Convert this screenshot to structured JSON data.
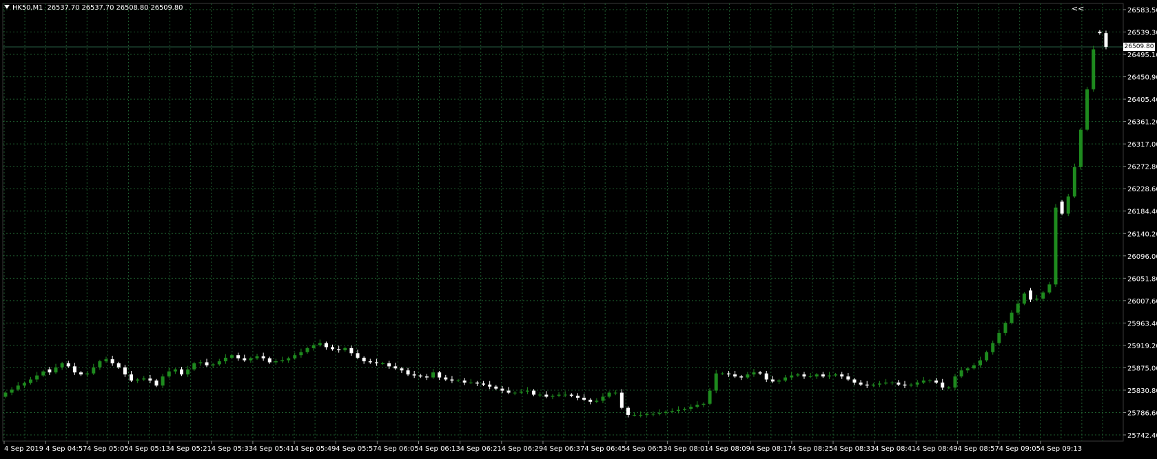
{
  "symbol_info": {
    "symbol": "HK50,M1",
    "open": "26537.70",
    "high": "26537.70",
    "low": "26508.80",
    "close": "26509.80"
  },
  "shift_button_label": "<<",
  "current_price_label": "26509.80",
  "colors": {
    "background": "#000000",
    "grid": "#1e5c2e",
    "bull_candle": "#1e8a1e",
    "bear_candle": "#ffffff",
    "bid_line": "#2e6e4e",
    "axis_text": "#ffffff"
  },
  "chart_data": {
    "type": "candlestick",
    "timeframe": "M1",
    "ylim": [
      25742.4,
      26583.5
    ],
    "grid": true,
    "y_tick_labels": [
      "26583.50",
      "26539.30",
      "26495.10",
      "26450.90",
      "26405.40",
      "26361.20",
      "26317.00",
      "26272.80",
      "26228.60",
      "26184.40",
      "26140.20",
      "26096.00",
      "26051.80",
      "26007.60",
      "25963.40",
      "25919.20",
      "25875.00",
      "25830.80",
      "25786.60",
      "25742.40"
    ],
    "x_tick_labels": [
      "4 Sep 2019",
      "4 Sep 04:57",
      "4 Sep 05:05",
      "4 Sep 05:13",
      "4 Sep 05:21",
      "4 Sep 05:33",
      "4 Sep 05:41",
      "4 Sep 05:49",
      "4 Sep 05:57",
      "4 Sep 06:05",
      "4 Sep 06:13",
      "4 Sep 06:21",
      "4 Sep 06:29",
      "4 Sep 06:37",
      "4 Sep 06:45",
      "4 Sep 06:53",
      "4 Sep 08:01",
      "4 Sep 08:09",
      "4 Sep 08:17",
      "4 Sep 08:25",
      "4 Sep 08:33",
      "4 Sep 08:41",
      "4 Sep 08:49",
      "4 Sep 08:57",
      "4 Sep 09:05",
      "4 Sep 09:13"
    ],
    "bid_line": 26509.8,
    "closes": [
      25826,
      25832,
      25840,
      25845,
      25852,
      25860,
      25868,
      25866,
      25876,
      25884,
      25878,
      25866,
      25862,
      25864,
      25876,
      25888,
      25892,
      25884,
      25876,
      25862,
      25850,
      25852,
      25854,
      25850,
      25840,
      25858,
      25868,
      25872,
      25862,
      25872,
      25884,
      25886,
      25880,
      25882,
      25888,
      25895,
      25900,
      25894,
      25890,
      25894,
      25898,
      25894,
      25886,
      25888,
      25890,
      25894,
      25900,
      25906,
      25914,
      25920,
      25924,
      25916,
      25912,
      25910,
      25914,
      25904,
      25895,
      25888,
      25886,
      25884,
      25884,
      25878,
      25874,
      25870,
      25862,
      25860,
      25858,
      25856,
      25866,
      25856,
      25852,
      25850,
      25850,
      25846,
      25846,
      25844,
      25842,
      25838,
      25834,
      25830,
      25826,
      25826,
      25828,
      25830,
      25822,
      25822,
      25818,
      25820,
      25822,
      25822,
      25820,
      25816,
      25812,
      25808,
      25810,
      25818,
      25826,
      25826,
      25796,
      25782,
      25782,
      25782,
      25784,
      25784,
      25786,
      25788,
      25790,
      25792,
      25794,
      25798,
      25802,
      25804,
      25830,
      25864,
      25864,
      25862,
      25858,
      25856,
      25862,
      25866,
      25864,
      25852,
      25848,
      25850,
      25856,
      25860,
      25862,
      25858,
      25858,
      25862,
      25858,
      25860,
      25862,
      25858,
      25852,
      25846,
      25842,
      25840,
      25842,
      25844,
      25846,
      25846,
      25842,
      25840,
      25842,
      25846,
      25850,
      25850,
      25846,
      25836,
      25836,
      25858,
      25870,
      25874,
      25880,
      25890,
      25906,
      25924,
      25944,
      25964,
      25984,
      26002,
      26022,
      26010,
      26012,
      26024,
      26040,
      26192,
      26180,
      26214,
      26272,
      26346,
      26426,
      26505,
      26537,
      26510
    ],
    "opens": [
      25818,
      25826,
      25832,
      25840,
      25845,
      25852,
      25860,
      25872,
      25866,
      25876,
      25884,
      25878,
      25866,
      25862,
      25864,
      25876,
      25888,
      25892,
      25884,
      25876,
      25862,
      25850,
      25852,
      25854,
      25850,
      25840,
      25858,
      25868,
      25872,
      25862,
      25872,
      25884,
      25886,
      25880,
      25882,
      25888,
      25895,
      25900,
      25894,
      25890,
      25894,
      25898,
      25894,
      25886,
      25888,
      25890,
      25894,
      25900,
      25906,
      25914,
      25920,
      25924,
      25916,
      25912,
      25910,
      25914,
      25904,
      25895,
      25888,
      25886,
      25884,
      25884,
      25878,
      25874,
      25870,
      25862,
      25860,
      25858,
      25856,
      25866,
      25856,
      25852,
      25850,
      25850,
      25846,
      25846,
      25844,
      25842,
      25838,
      25834,
      25830,
      25826,
      25826,
      25828,
      25830,
      25822,
      25822,
      25818,
      25820,
      25822,
      25822,
      25820,
      25816,
      25812,
      25808,
      25810,
      25818,
      25826,
      25826,
      25796,
      25782,
      25782,
      25782,
      25784,
      25784,
      25786,
      25788,
      25790,
      25792,
      25794,
      25798,
      25802,
      25804,
      25830,
      25864,
      25864,
      25862,
      25858,
      25856,
      25862,
      25866,
      25864,
      25852,
      25848,
      25850,
      25856,
      25860,
      25862,
      25858,
      25858,
      25862,
      25858,
      25860,
      25862,
      25858,
      25852,
      25846,
      25842,
      25840,
      25842,
      25844,
      25846,
      25846,
      25842,
      25840,
      25842,
      25846,
      25850,
      25850,
      25846,
      25836,
      25836,
      25858,
      25870,
      25874,
      25880,
      25890,
      25906,
      25924,
      25944,
      25964,
      25984,
      26002,
      26028,
      26010,
      26012,
      26024,
      26040,
      26204,
      26180,
      26214,
      26272,
      26346,
      26426,
      26540,
      26537
    ]
  }
}
